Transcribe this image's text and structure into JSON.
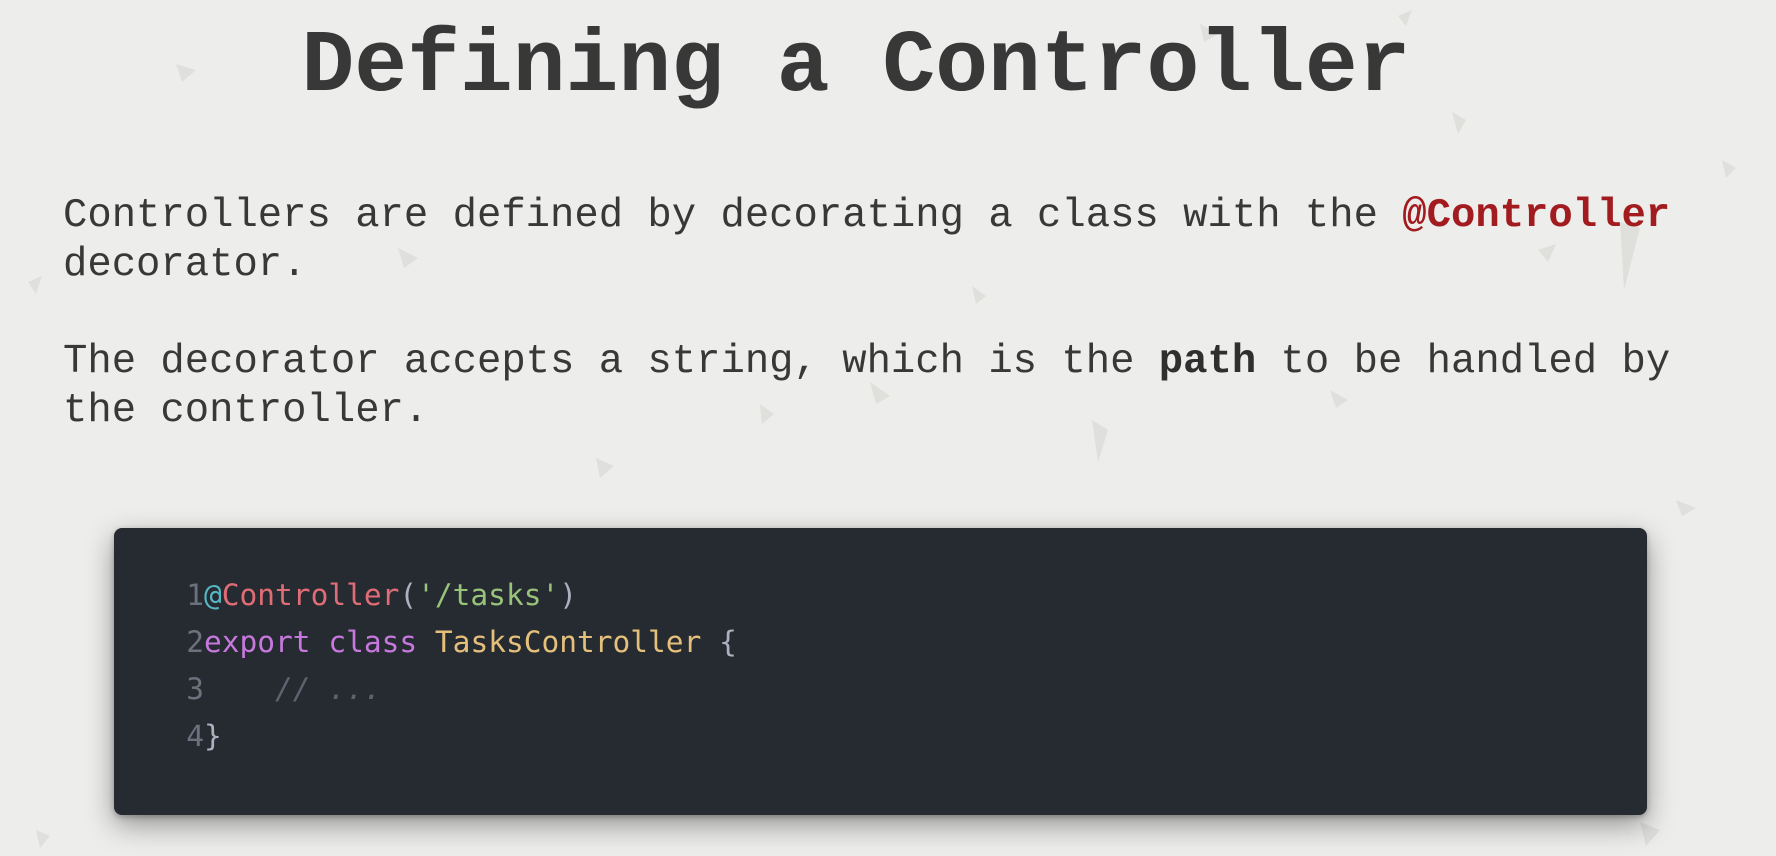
{
  "slide": {
    "title": "Defining a Controller",
    "paragraph1": {
      "before": "Controllers are defined by decorating a class with the ",
      "highlight": "@Controller",
      "after": "\ndecorator."
    },
    "paragraph2": {
      "before": "The decorator accepts a string, which is the ",
      "bold": "path",
      "after": " to be handled by\nthe controller."
    }
  },
  "code": {
    "language": "typescript",
    "lines": [
      {
        "number": "1",
        "tokens": [
          {
            "type": "at",
            "text": "@"
          },
          {
            "type": "dec",
            "text": "Controller"
          },
          {
            "type": "punc",
            "text": "("
          },
          {
            "type": "str",
            "text": "'/tasks'"
          },
          {
            "type": "punc",
            "text": ")"
          }
        ]
      },
      {
        "number": "2",
        "tokens": [
          {
            "type": "kw",
            "text": "export"
          },
          {
            "type": "punc",
            "text": " "
          },
          {
            "type": "kw",
            "text": "class"
          },
          {
            "type": "punc",
            "text": " "
          },
          {
            "type": "cls",
            "text": "TasksController"
          },
          {
            "type": "punc",
            "text": " {"
          }
        ]
      },
      {
        "number": "3",
        "tokens": [
          {
            "type": "punc",
            "text": "    "
          },
          {
            "type": "cmt",
            "text": "// ..."
          }
        ]
      },
      {
        "number": "4",
        "tokens": [
          {
            "type": "punc",
            "text": "}"
          }
        ]
      }
    ]
  },
  "colors": {
    "background": "#ededeb",
    "text": "#383838",
    "accent": "#a21b1f",
    "code_background": "#262a31"
  }
}
